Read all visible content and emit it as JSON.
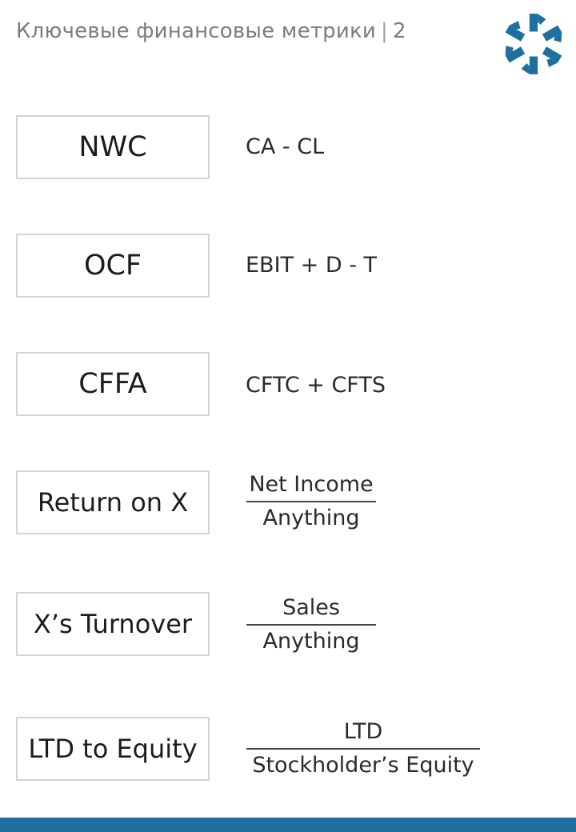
{
  "header": {
    "title": "Ключевые финансовые метрики",
    "separator": "|",
    "page_number": "2"
  },
  "colors": {
    "brand_blue": "#1f6f9e",
    "box_border": "#d4d4d4"
  },
  "logo": {
    "icon": "snowflake-logo-icon"
  },
  "metrics": [
    {
      "label": "NWC",
      "formula": "CA - CL"
    },
    {
      "label": "OCF",
      "formula": "EBIT + D - T"
    },
    {
      "label": "CFFA",
      "formula": "CFTC + CFTS"
    },
    {
      "label": "Return on X",
      "numerator": "Net Income",
      "denominator": "Anything"
    },
    {
      "label": "X’s Turnover",
      "numerator": "Sales",
      "denominator": "Anything"
    },
    {
      "label": "LTD to Equity",
      "numerator": "LTD",
      "denominator": "Stockholder’s Equity"
    }
  ]
}
